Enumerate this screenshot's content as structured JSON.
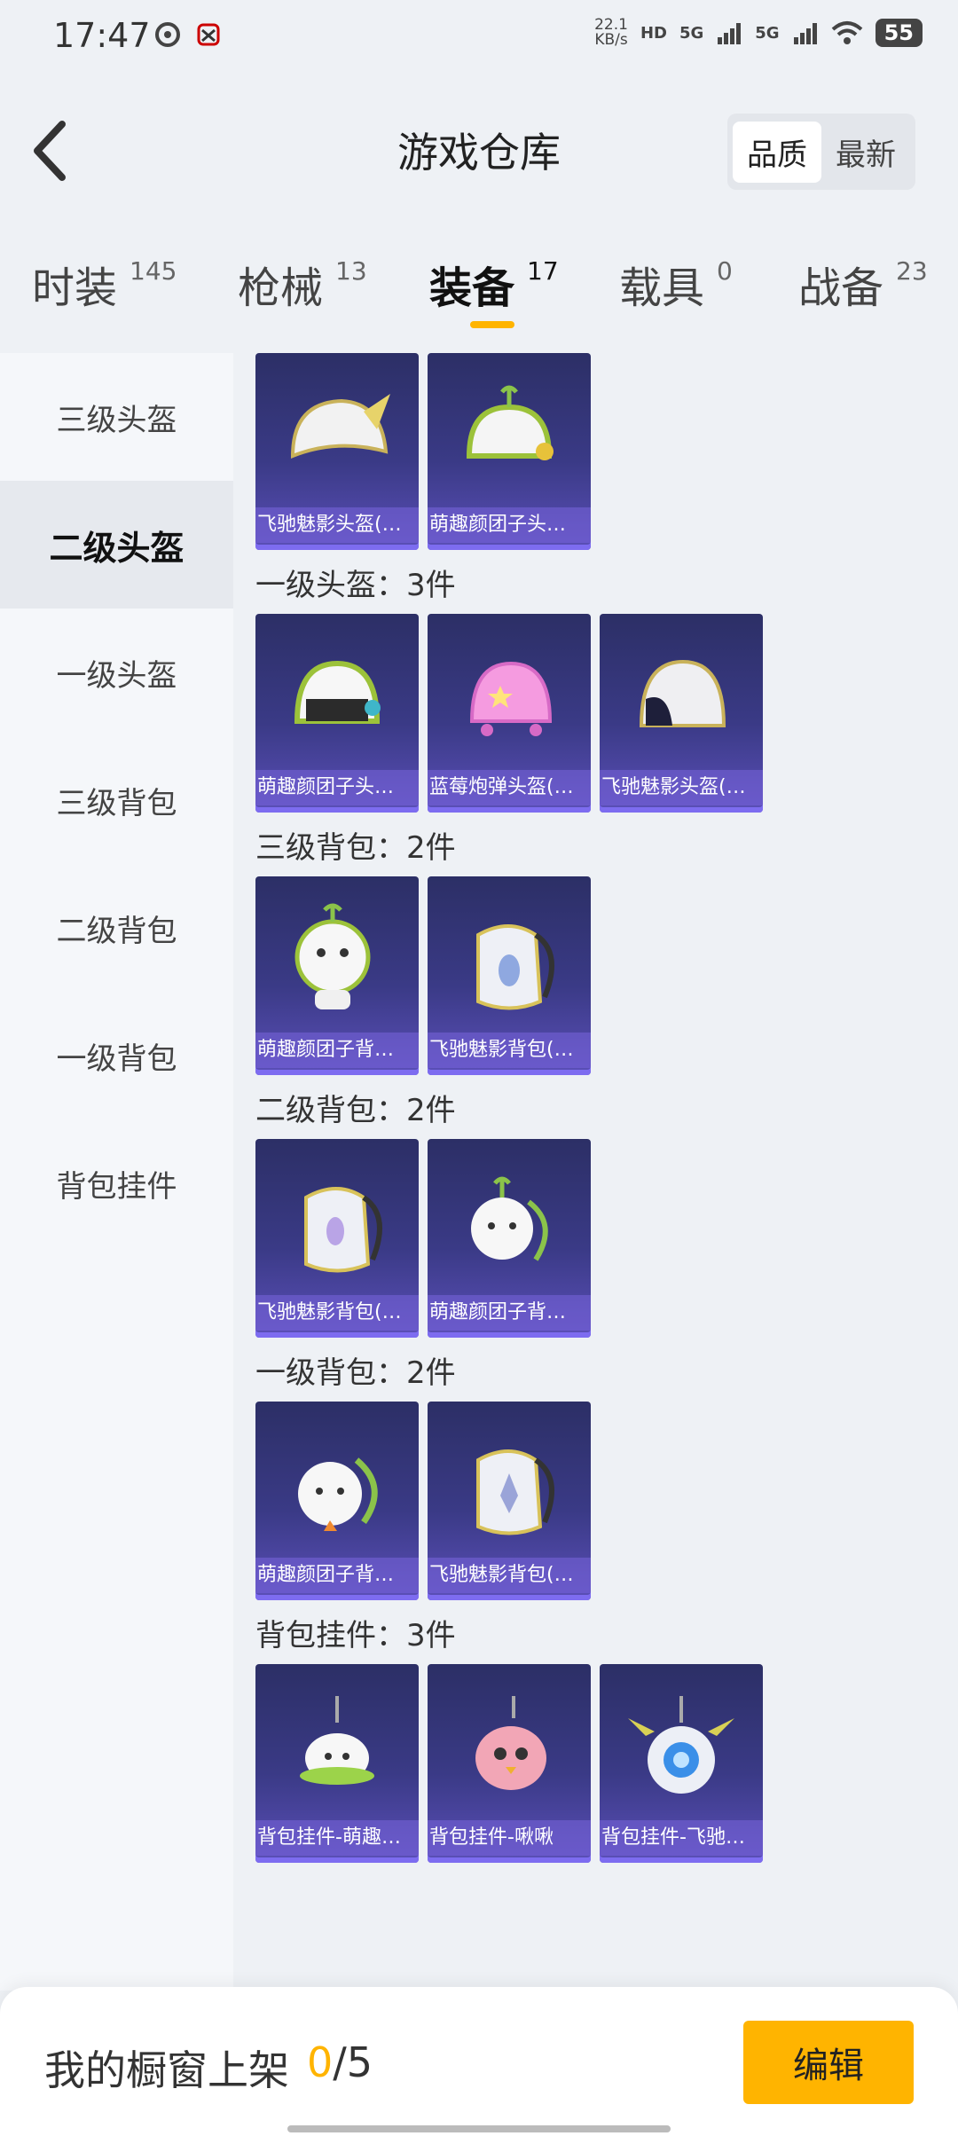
{
  "status_bar": {
    "time": "17:47",
    "speed_value": "22.1",
    "speed_unit": "KB/s",
    "hd_label": "HD",
    "sim1": "5G",
    "sim2": "5G",
    "battery": "55"
  },
  "header": {
    "title": "游戏仓库",
    "sort_quality": "品质",
    "sort_newest": "最新"
  },
  "tabs": [
    {
      "label": "时装",
      "count": "145"
    },
    {
      "label": "枪械",
      "count": "13"
    },
    {
      "label": "装备",
      "count": "17"
    },
    {
      "label": "载具",
      "count": "0"
    },
    {
      "label": "战备",
      "count": "23"
    }
  ],
  "sidebar": [
    {
      "label": "三级头盔"
    },
    {
      "label": "二级头盔"
    },
    {
      "label": "一级头盔"
    },
    {
      "label": "三级背包"
    },
    {
      "label": "二级背包"
    },
    {
      "label": "一级背包"
    },
    {
      "label": "背包挂件"
    }
  ],
  "sections": [
    {
      "title": "",
      "items": [
        {
          "name": "飞驰魅影头盔(…",
          "icon": "helmet-icon"
        },
        {
          "name": "萌趣颜团子头…",
          "icon": "helmet-icon"
        }
      ]
    },
    {
      "title": "一级头盔：3件",
      "items": [
        {
          "name": "萌趣颜团子头…",
          "icon": "helmet-icon"
        },
        {
          "name": "蓝莓炮弹头盔(…",
          "icon": "helmet-icon"
        },
        {
          "name": "飞驰魅影头盔(…",
          "icon": "helmet-icon"
        }
      ]
    },
    {
      "title": "三级背包：2件",
      "items": [
        {
          "name": "萌趣颜团子背…",
          "icon": "backpack-icon"
        },
        {
          "name": "飞驰魅影背包(…",
          "icon": "backpack-icon"
        }
      ]
    },
    {
      "title": "二级背包：2件",
      "items": [
        {
          "name": "飞驰魅影背包(…",
          "icon": "backpack-icon"
        },
        {
          "name": "萌趣颜团子背…",
          "icon": "backpack-icon"
        }
      ]
    },
    {
      "title": "一级背包：2件",
      "items": [
        {
          "name": "萌趣颜团子背…",
          "icon": "backpack-icon"
        },
        {
          "name": "飞驰魅影背包(…",
          "icon": "backpack-icon"
        }
      ]
    },
    {
      "title": "背包挂件：3件",
      "items": [
        {
          "name": "背包挂件-萌趣…",
          "icon": "charm-icon"
        },
        {
          "name": "背包挂件-啾啾",
          "icon": "charm-icon"
        },
        {
          "name": "背包挂件-飞驰…",
          "icon": "charm-icon"
        }
      ]
    }
  ],
  "bottom": {
    "shelf_label": "我的橱窗上架",
    "shelf_current": "0",
    "shelf_separator": "/",
    "shelf_total": "5",
    "edit_button": "编辑"
  },
  "colors": {
    "accent": "#ffb400",
    "card_top": "#2c2f66",
    "card_bottom": "#5b4fb8"
  }
}
